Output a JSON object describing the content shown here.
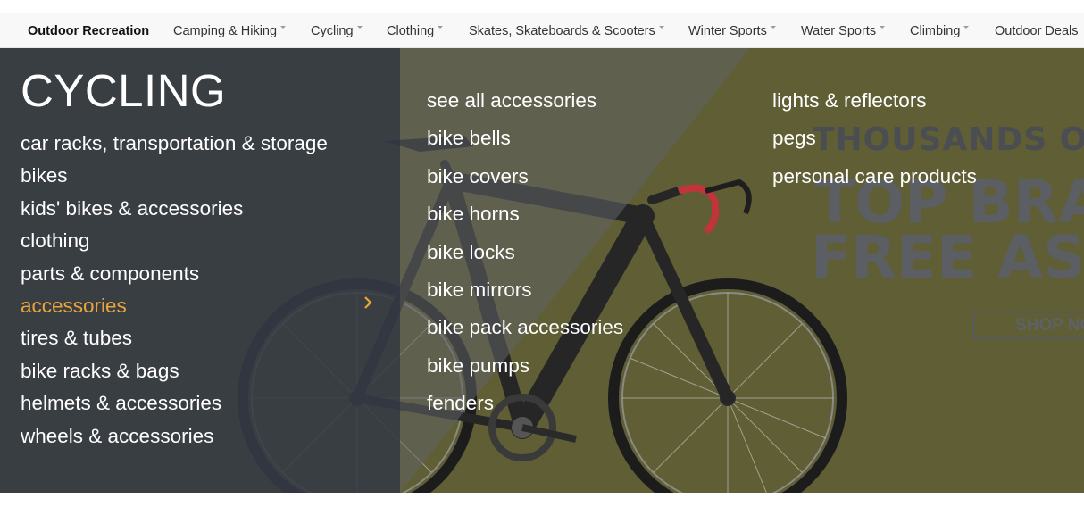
{
  "topnav": {
    "items": [
      {
        "label": "Outdoor Recreation",
        "has_dropdown": false,
        "active": true
      },
      {
        "label": "Camping & Hiking",
        "has_dropdown": true
      },
      {
        "label": "Cycling",
        "has_dropdown": true
      },
      {
        "label": "Clothing",
        "has_dropdown": true
      },
      {
        "label": "Skates, Skateboards & Scooters",
        "has_dropdown": true
      },
      {
        "label": "Winter Sports",
        "has_dropdown": true
      },
      {
        "label": "Water Sports",
        "has_dropdown": true
      },
      {
        "label": "Climbing",
        "has_dropdown": true
      },
      {
        "label": "Outdoor Deals",
        "has_dropdown": false
      }
    ]
  },
  "dropdown": {
    "title": "CYCLING",
    "left_items": [
      "car racks, transportation & storage",
      "bikes",
      "kids' bikes & accessories",
      "clothing",
      "parts & components",
      "accessories",
      "tires & tubes",
      "bike racks & bags",
      "helmets & accessories",
      "wheels & accessories"
    ],
    "active_item": "accessories",
    "middle_items": [
      "see all accessories",
      "bike bells",
      "bike covers",
      "bike horns",
      "bike locks",
      "bike mirrors",
      "bike pack accessories",
      "bike pumps",
      "fenders"
    ],
    "right_items": [
      "lights & reflectors",
      "pegs",
      "personal care products"
    ]
  },
  "promo": {
    "line1": "THOUSANDS OF",
    "line2": "TOP BRA",
    "line3": "FREE ASS",
    "button": "SHOP NO"
  },
  "colors": {
    "accent": "#e8a53a",
    "panel": "#343a46",
    "hero_olive": "#5a5a34"
  }
}
